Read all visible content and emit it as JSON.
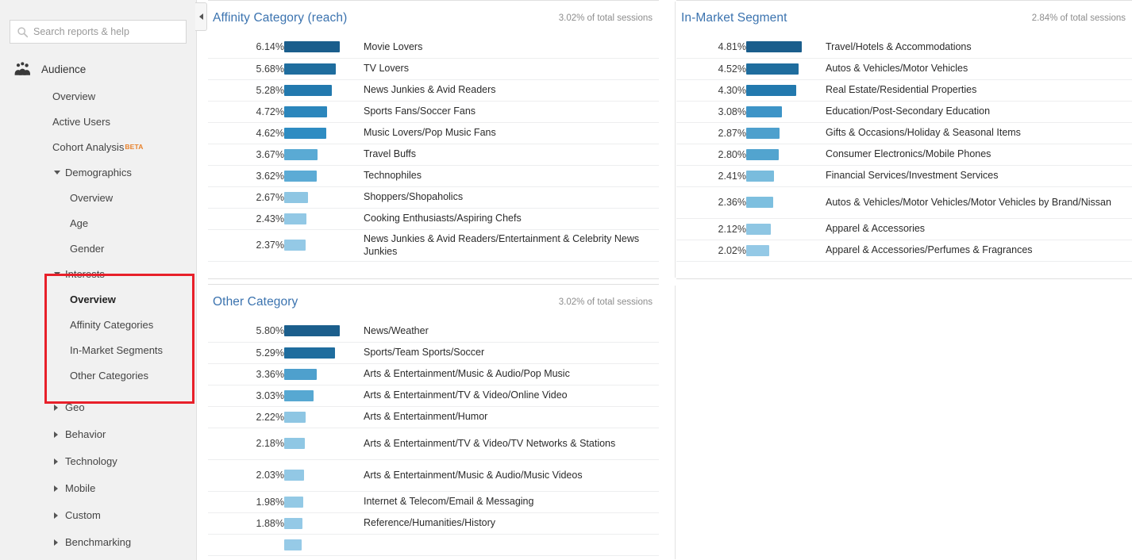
{
  "sidebar": {
    "search": {
      "placeholder": "Search reports & help",
      "icon": "search-icon"
    },
    "section": {
      "label": "Audience",
      "icon": "audience-people-icon"
    },
    "items": [
      {
        "label": "Overview",
        "level": 1
      },
      {
        "label": "Active Users",
        "level": 1
      },
      {
        "label": "Cohort Analysis",
        "level": 1,
        "badge": "BETA"
      },
      {
        "label": "Demographics",
        "level": 1,
        "caret": "down"
      },
      {
        "label": "Overview",
        "level": 2
      },
      {
        "label": "Age",
        "level": 2
      },
      {
        "label": "Gender",
        "level": 2
      },
      {
        "label": "Interests",
        "level": 1,
        "caret": "down"
      },
      {
        "label": "Overview",
        "level": 2,
        "selected": true
      },
      {
        "label": "Affinity Categories",
        "level": 2
      },
      {
        "label": "In-Market Segments",
        "level": 2
      },
      {
        "label": "Other Categories",
        "level": 2
      },
      {
        "label": "Geo",
        "level": 1,
        "caret": "right"
      },
      {
        "label": "Behavior",
        "level": 1,
        "caret": "right"
      },
      {
        "label": "Technology",
        "level": 1,
        "caret": "right"
      },
      {
        "label": "Mobile",
        "level": 1,
        "caret": "right"
      },
      {
        "label": "Custom",
        "level": 1,
        "caret": "right"
      },
      {
        "label": "Benchmarking",
        "level": 1,
        "caret": "right"
      }
    ],
    "highlight_color": "#e8202a",
    "collapse_handle": "collapse-sidebar-icon"
  },
  "chart_data": [
    {
      "type": "bar",
      "title": "Affinity Category (reach)",
      "subtitle": "3.02% of total sessions",
      "xlabel": "",
      "ylabel": "",
      "orientation": "horizontal",
      "value_suffix": "%",
      "max_value": 6.14,
      "categories": [
        "Movie Lovers",
        "TV Lovers",
        "News Junkies & Avid Readers",
        "Sports Fans/Soccer Fans",
        "Music Lovers/Pop Music Fans",
        "Travel Buffs",
        "Technophiles",
        "Shoppers/Shopaholics",
        "Cooking Enthusiasts/Aspiring Chefs",
        "News Junkies & Avid Readers/Entertainment & Celebrity News Junkies"
      ],
      "values": [
        6.14,
        5.68,
        5.28,
        4.72,
        4.62,
        3.67,
        3.62,
        2.67,
        2.43,
        2.37
      ],
      "labels": [
        "6.14%",
        "5.68%",
        "5.28%",
        "4.72%",
        "4.62%",
        "3.67%",
        "3.62%",
        "2.67%",
        "2.43%",
        "2.37%"
      ],
      "colors": [
        "#1b5e8c",
        "#1f6d9e",
        "#2279ae",
        "#2b86bc",
        "#2e8cc2",
        "#5aaad4",
        "#5cabd5",
        "#8ec6e3",
        "#92c8e5",
        "#94c9e6"
      ]
    },
    {
      "type": "bar",
      "title": "In-Market Segment",
      "subtitle": "2.84% of total sessions",
      "xlabel": "",
      "ylabel": "",
      "orientation": "horizontal",
      "value_suffix": "%",
      "max_value": 4.81,
      "categories": [
        "Travel/Hotels & Accommodations",
        "Autos & Vehicles/Motor Vehicles",
        "Real Estate/Residential Properties",
        "Education/Post-Secondary Education",
        "Gifts & Occasions/Holiday & Seasonal Items",
        "Consumer Electronics/Mobile Phones",
        "Financial Services/Investment Services",
        "Autos & Vehicles/Motor Vehicles/Motor Vehicles by Brand/Nissan",
        "Apparel & Accessories",
        "Apparel & Accessories/Perfumes & Fragrances"
      ],
      "values": [
        4.81,
        4.52,
        4.3,
        3.08,
        2.87,
        2.8,
        2.41,
        2.36,
        2.12,
        2.02
      ],
      "labels": [
        "4.81%",
        "4.52%",
        "4.30%",
        "3.08%",
        "2.87%",
        "2.80%",
        "2.41%",
        "2.36%",
        "2.12%",
        "2.02%"
      ],
      "colors": [
        "#1b5e8c",
        "#1f6d9e",
        "#2279ae",
        "#3d94c7",
        "#4ea0cd",
        "#52a4cf",
        "#79bcdd",
        "#7dbfdf",
        "#8ec6e3",
        "#94c9e6"
      ]
    },
    {
      "type": "bar",
      "title": "Other Category",
      "subtitle": "3.02% of total sessions",
      "xlabel": "",
      "ylabel": "",
      "orientation": "horizontal",
      "value_suffix": "%",
      "max_value": 5.8,
      "categories": [
        "News/Weather",
        "Sports/Team Sports/Soccer",
        "Arts & Entertainment/Music & Audio/Pop Music",
        "Arts & Entertainment/TV & Video/Online Video",
        "Arts & Entertainment/Humor",
        "Arts & Entertainment/TV & Video/TV Networks & Stations",
        "Arts & Entertainment/Music & Audio/Music Videos",
        "Internet & Telecom/Email & Messaging",
        "Reference/Humanities/History",
        ""
      ],
      "values": [
        5.8,
        5.29,
        3.36,
        3.03,
        2.22,
        2.18,
        2.03,
        1.98,
        1.88,
        1.8
      ],
      "labels": [
        "5.80%",
        "5.29%",
        "3.36%",
        "3.03%",
        "2.22%",
        "2.18%",
        "2.03%",
        "1.98%",
        "1.88%",
        ""
      ],
      "colors": [
        "#1b5e8c",
        "#1f6d9e",
        "#4ea0cd",
        "#57a8d2",
        "#8ec6e3",
        "#8fc7e4",
        "#92c8e5",
        "#93c9e5",
        "#94c9e6",
        "#96cae7"
      ]
    }
  ]
}
